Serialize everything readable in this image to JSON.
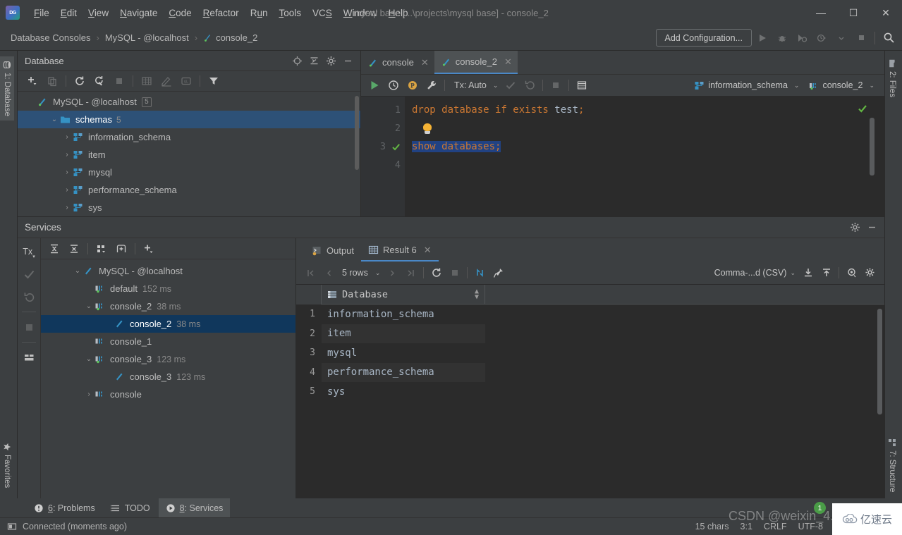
{
  "window": {
    "title": "mysql base [...\\projects\\mysql base] - console_2",
    "minimize": "—",
    "maximize": "☐",
    "close": "✕"
  },
  "menu": {
    "items": [
      {
        "label": "File"
      },
      {
        "label": "Edit"
      },
      {
        "label": "View"
      },
      {
        "label": "Navigate"
      },
      {
        "label": "Code"
      },
      {
        "label": "Refactor"
      },
      {
        "label": "Run"
      },
      {
        "label": "Tools"
      },
      {
        "label": "VCS"
      },
      {
        "label": "Window"
      },
      {
        "label": "Help"
      }
    ]
  },
  "breadcrumb": {
    "items": [
      "Database Consoles",
      "MySQL - @localhost",
      "console_2"
    ],
    "separator": "›"
  },
  "navbar": {
    "add_configuration": "Add Configuration...",
    "icons": [
      "run-icon",
      "debug-icon",
      "run-coverage-icon",
      "profile-icon",
      "dropdown-icon",
      "stop-icon",
      "search-icon"
    ]
  },
  "left_strip": {
    "database_tab": "1: Database",
    "database_tab_mnemonic": "1",
    "favorites_tab": "Favorites"
  },
  "right_strip": {
    "files_tab": "2: Files",
    "structure_tab": "7: Structure"
  },
  "database_panel": {
    "title": "Database",
    "header_icons": [
      "locate-icon",
      "collapse-all-icon",
      "gear-icon",
      "hide-icon"
    ],
    "toolbar_icons": [
      "add-icon",
      "copy-icon",
      "refresh-icon",
      "sync-icon",
      "stop-icon",
      "table-icon",
      "edit-icon",
      "query-console-icon",
      "filter-icon"
    ],
    "tree": [
      {
        "label": "MySQL - @localhost",
        "badge": "5",
        "indent": 0,
        "chevron": "",
        "icon": "console-icon",
        "selected": false
      },
      {
        "label": "schemas",
        "count": "5",
        "indent": 1,
        "chevron": "⌄",
        "icon": "folder-icon",
        "selected": true
      },
      {
        "label": "information_schema",
        "count": "",
        "indent": 2,
        "chevron": "›",
        "icon": "schema-icon",
        "selected": false
      },
      {
        "label": "item",
        "count": "",
        "indent": 2,
        "chevron": "›",
        "icon": "schema-icon",
        "selected": false
      },
      {
        "label": "mysql",
        "count": "",
        "indent": 2,
        "chevron": "›",
        "icon": "schema-icon",
        "selected": false
      },
      {
        "label": "performance_schema",
        "count": "",
        "indent": 2,
        "chevron": "›",
        "icon": "schema-icon",
        "selected": false
      },
      {
        "label": "sys",
        "count": "",
        "indent": 2,
        "chevron": "›",
        "icon": "schema-icon",
        "selected": false
      }
    ]
  },
  "editor": {
    "tabs": [
      {
        "label": "console",
        "active": false,
        "close": "✕"
      },
      {
        "label": "console_2",
        "active": true,
        "close": "✕"
      }
    ],
    "toolbar": {
      "tx_label": "Tx: Auto",
      "schema": "information_schema",
      "session": "console_2",
      "caret": "⌄",
      "icons": [
        "execute-icon",
        "history-icon",
        "parameters-icon",
        "wrench-icon",
        "commit-icon",
        "rollback-icon",
        "stop-icon",
        "data-source-icon"
      ]
    },
    "lines": [
      {
        "number": "1",
        "status": "check",
        "tokens": [
          {
            "t": "drop database if exists ",
            "c": "kw"
          },
          {
            "t": "test",
            "c": "plain"
          },
          {
            "t": ";",
            "c": "kw"
          }
        ]
      },
      {
        "number": "2",
        "status": "bulb",
        "tokens": []
      },
      {
        "number": "3",
        "status": "check",
        "selected": true,
        "tokens": [
          {
            "t": "show databases",
            "c": "kw"
          },
          {
            "t": ";",
            "c": "kw"
          }
        ]
      },
      {
        "number": "4",
        "status": "",
        "tokens": []
      }
    ]
  },
  "services": {
    "title": "Services",
    "header_icons": [
      "gear-icon",
      "hide-icon"
    ],
    "side_icons": [
      "tx-icon",
      "commit-icon",
      "rollback-icon",
      "stop-icon",
      "layout-icon"
    ],
    "toolbar_icons": [
      "expand-all-icon",
      "collapse-all-icon",
      "group-icon",
      "add-tab-icon",
      "add-icon"
    ],
    "tx_label": "Tx",
    "tree": [
      {
        "label": "MySQL - @localhost",
        "time": "",
        "indent": 0,
        "chevron": "⌄",
        "icon": "console-icon",
        "selected": false
      },
      {
        "label": "default",
        "time": "152 ms",
        "indent": 1,
        "chevron": "",
        "icon": "session-icon",
        "selected": false
      },
      {
        "label": "console_2",
        "time": "38 ms",
        "indent": 1,
        "chevron": "⌄",
        "icon": "session-icon",
        "selected": false
      },
      {
        "label": "console_2",
        "time": "38 ms",
        "indent": 2,
        "chevron": "",
        "icon": "console-icon",
        "selected": true
      },
      {
        "label": "console_1",
        "time": "",
        "indent": 1,
        "chevron": "",
        "icon": "session-icon",
        "selected": false
      },
      {
        "label": "console_3",
        "time": "123 ms",
        "indent": 1,
        "chevron": "⌄",
        "icon": "session-icon",
        "selected": false
      },
      {
        "label": "console_3",
        "time": "123 ms",
        "indent": 2,
        "chevron": "",
        "icon": "console-icon",
        "selected": false
      },
      {
        "label": "console",
        "time": "",
        "indent": 1,
        "chevron": "›",
        "icon": "session-icon",
        "selected": false
      }
    ]
  },
  "result": {
    "tabs": [
      {
        "label": "Output",
        "active": false,
        "icon": "output-icon",
        "close": ""
      },
      {
        "label": "Result 6",
        "active": true,
        "icon": "grid-icon",
        "close": "✕"
      }
    ],
    "toolbar": {
      "rows_label": "5 rows",
      "export_format": "Comma-...d (CSV)",
      "caret": "⌄",
      "icons": [
        "first-page-icon",
        "prev-page-icon",
        "next-page-icon",
        "last-page-icon",
        "reload-icon",
        "stop-icon",
        "transpose-icon",
        "pin-icon",
        "download-icon",
        "upload-icon",
        "view-icon",
        "settings-icon"
      ]
    },
    "columns": [
      "Database"
    ],
    "rows": [
      {
        "n": "1",
        "values": [
          "information_schema"
        ]
      },
      {
        "n": "2",
        "values": [
          "item"
        ]
      },
      {
        "n": "3",
        "values": [
          "mysql"
        ]
      },
      {
        "n": "4",
        "values": [
          "performance_schema"
        ]
      },
      {
        "n": "5",
        "values": [
          "sys"
        ]
      }
    ]
  },
  "bottom_tabs": [
    {
      "label": "6: Problems",
      "mnemonic": "6",
      "icon": "problems-icon",
      "active": false
    },
    {
      "label": "TODO",
      "mnemonic": "",
      "icon": "todo-icon",
      "active": false
    },
    {
      "label": "8: Services",
      "mnemonic": "8",
      "icon": "services-icon",
      "active": true
    }
  ],
  "statusbar": {
    "connection": "Connected (moments ago)",
    "chars": "15 chars",
    "caret_position": "3:1",
    "line_separator": "CRLF",
    "encoding": "UTF-8",
    "notification_count": "1"
  },
  "watermarks": {
    "csdn": "CSDN @weixin_4...",
    "brand": "亿速云",
    "brand_icon": "cloud-icon"
  },
  "colors": {
    "accent_blue": "#4a88c7",
    "selection_blue": "#214283",
    "tree_selection": "#2d5177",
    "keyword_orange": "#cc7832",
    "plain_text": "#a9b7c6",
    "success_green": "#62b543",
    "panel_bg": "#3c3f41",
    "editor_bg": "#2b2b2b"
  }
}
